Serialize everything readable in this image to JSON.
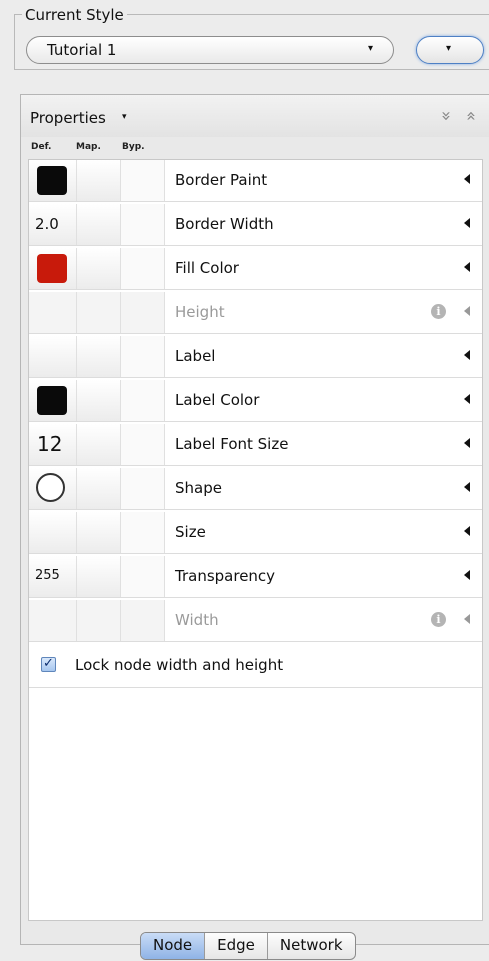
{
  "current_style": {
    "legend": "Current Style",
    "selected": "Tutorial 1",
    "dropdown_glyph": "▾",
    "options_button_glyph": "▾"
  },
  "properties": {
    "title": "Properties",
    "title_glyph": "▾",
    "expand_icon": "»",
    "collapse_icon": "«",
    "columns": [
      "Def.",
      "Map.",
      "Byp."
    ],
    "rows": [
      {
        "label": "Border Paint",
        "def_type": "swatch",
        "def_color": "#0a0a0a",
        "def_value": "",
        "enabled": true
      },
      {
        "label": "Border Width",
        "def_type": "text",
        "def_value": "2.0",
        "enabled": true
      },
      {
        "label": "Fill Color",
        "def_type": "swatch",
        "def_color": "#c81a0b",
        "def_value": "",
        "enabled": true
      },
      {
        "label": "Height",
        "def_type": "none",
        "def_value": "",
        "enabled": false,
        "info": true
      },
      {
        "label": "Label",
        "def_type": "blank",
        "def_value": "",
        "enabled": true
      },
      {
        "label": "Label Color",
        "def_type": "swatch",
        "def_color": "#0a0a0a",
        "def_value": "",
        "enabled": true
      },
      {
        "label": "Label Font Size",
        "def_type": "bigtext",
        "def_value": "12",
        "enabled": true
      },
      {
        "label": "Shape",
        "def_type": "circle",
        "def_value": "",
        "enabled": true
      },
      {
        "label": "Size",
        "def_type": "blank",
        "def_value": "",
        "enabled": true
      },
      {
        "label": "Transparency",
        "def_type": "smalltext",
        "def_value": "255",
        "enabled": true
      },
      {
        "label": "Width",
        "def_type": "none",
        "def_value": "",
        "enabled": false,
        "info": true
      }
    ],
    "info_glyph": "i",
    "lock": {
      "label": "Lock node width and height",
      "checked": true,
      "check_glyph": "✓"
    }
  },
  "tabs": [
    {
      "label": "Node",
      "active": true
    },
    {
      "label": "Edge",
      "active": false
    },
    {
      "label": "Network",
      "active": false
    }
  ]
}
